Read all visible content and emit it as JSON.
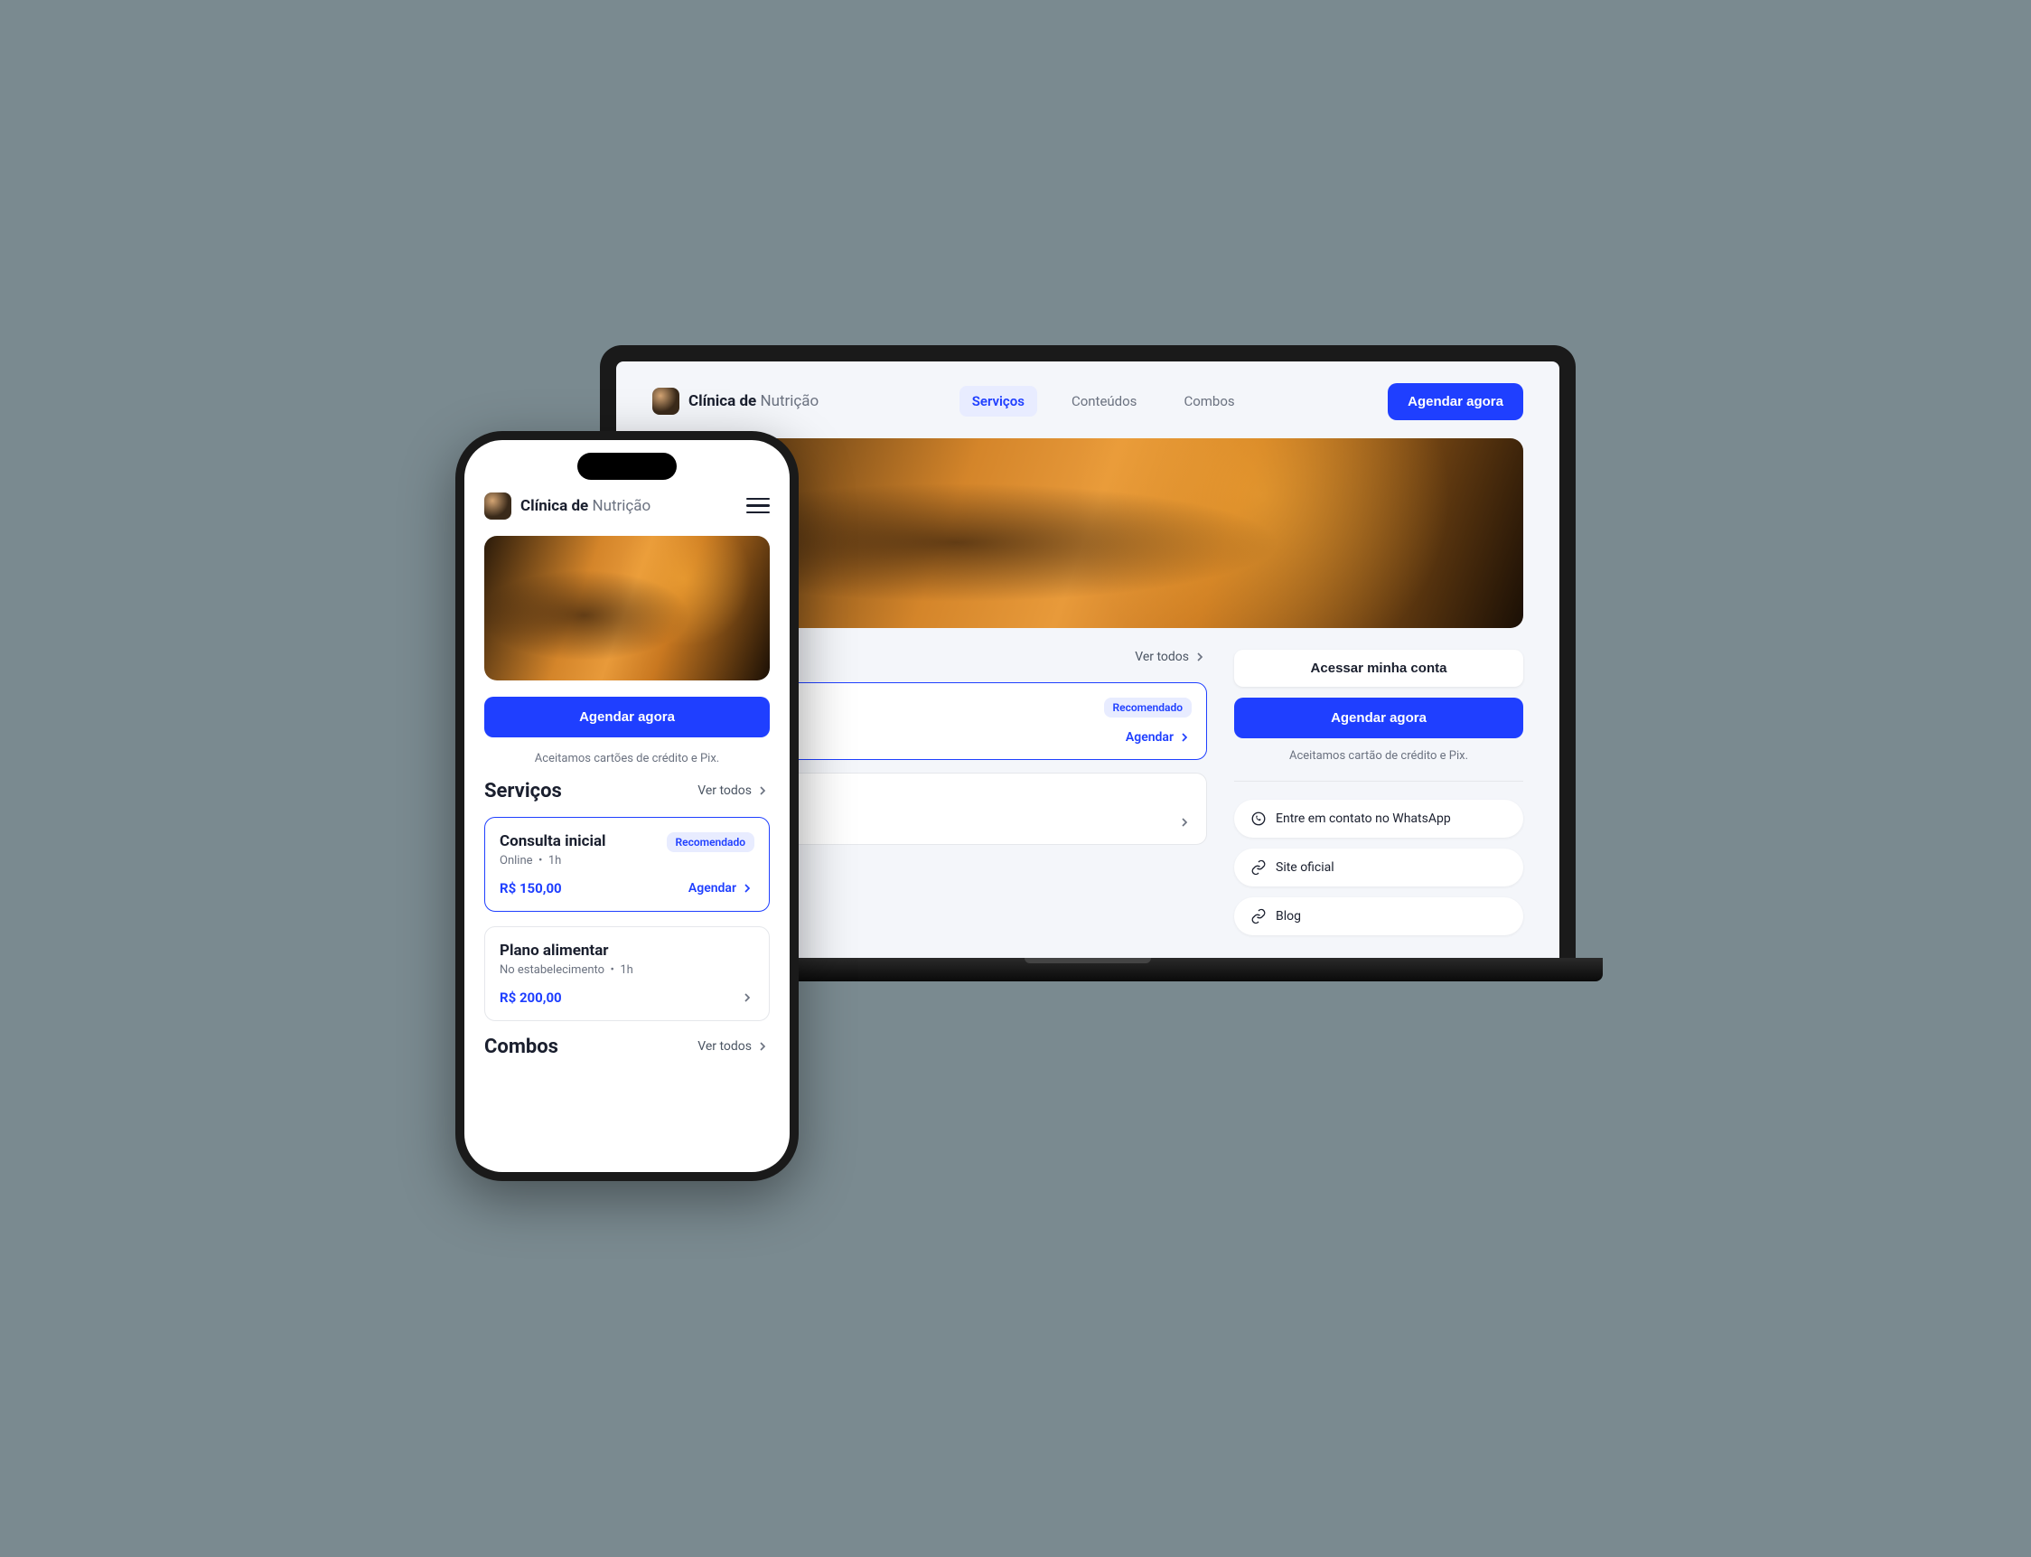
{
  "brand": {
    "part1": "Clínica",
    "part2": "de",
    "part3": "Nutrição"
  },
  "nav": {
    "servicos": "Serviços",
    "conteudos": "Conteúdos",
    "combos": "Combos"
  },
  "cta": {
    "agendar": "Agendar agora",
    "acessar": "Acessar minha conta"
  },
  "caption": {
    "desktop": "Aceitamos cartão de crédito e Pix.",
    "mobile": "Aceitamos cartões de crédito e Pix."
  },
  "see_all": "Ver todos",
  "sections": {
    "servicos": "Serviços",
    "combos": "Combos"
  },
  "badge": {
    "recomendado": "Recomendado"
  },
  "action": {
    "agendar": "Agendar"
  },
  "services": [
    {
      "title": "Consulta inicial",
      "mode": "Online",
      "duration": "1h",
      "price": "R$ 150,00",
      "recommended": true
    },
    {
      "title": "Plano alimentar",
      "mode": "No estabelecimento",
      "duration": "1h",
      "price": "R$ 200,00",
      "recommended": false
    }
  ],
  "links": {
    "whatsapp": "Entre em contato no WhatsApp",
    "site": "Site oficial",
    "blog": "Blog"
  }
}
